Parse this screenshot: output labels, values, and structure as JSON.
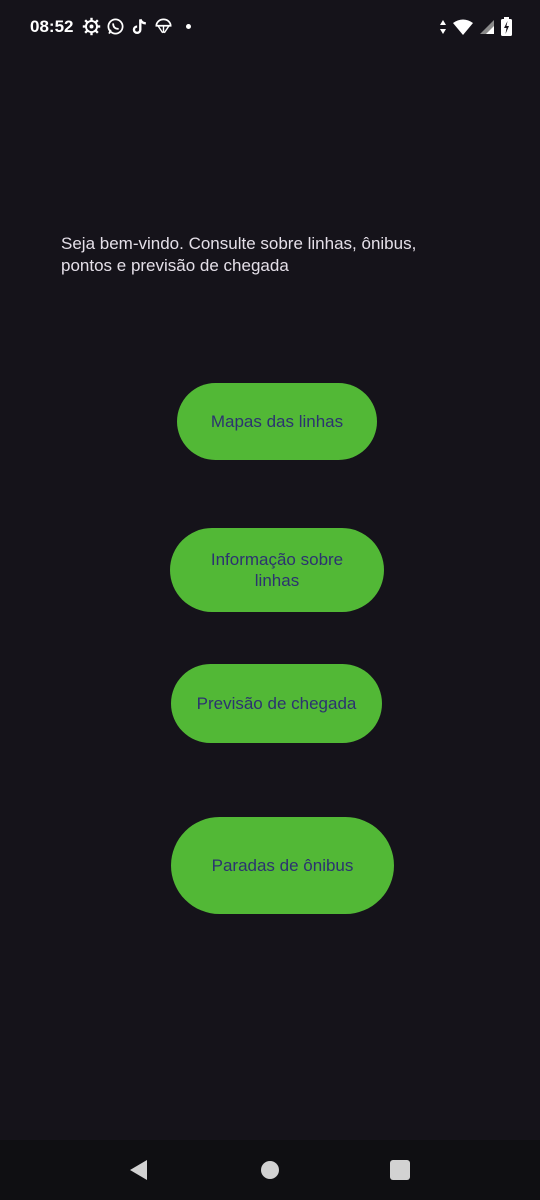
{
  "status_bar": {
    "time": "08:52",
    "left_icons": [
      "settings-icon",
      "whatsapp-icon",
      "tiktok-icon",
      "parachute-icon",
      "notification-dot-icon"
    ],
    "right_icons": [
      "data-arrows-icon",
      "wifi-icon",
      "signal-icon",
      "battery-charging-icon"
    ]
  },
  "welcome_text": "Seja bem-vindo. Consulte sobre linhas, ônibus, pontos e previsão de chegada",
  "buttons": {
    "maps": "Mapas das linhas",
    "info": "Informação sobre linhas",
    "prediction": "Previsão de chegada",
    "stops": "Paradas de ônibus"
  },
  "colors": {
    "background": "#15131a",
    "button_bg": "#52b836",
    "button_text": "#2c3370"
  },
  "nav_bar": {
    "icons": [
      "back-icon",
      "home-icon",
      "recents-icon"
    ]
  }
}
